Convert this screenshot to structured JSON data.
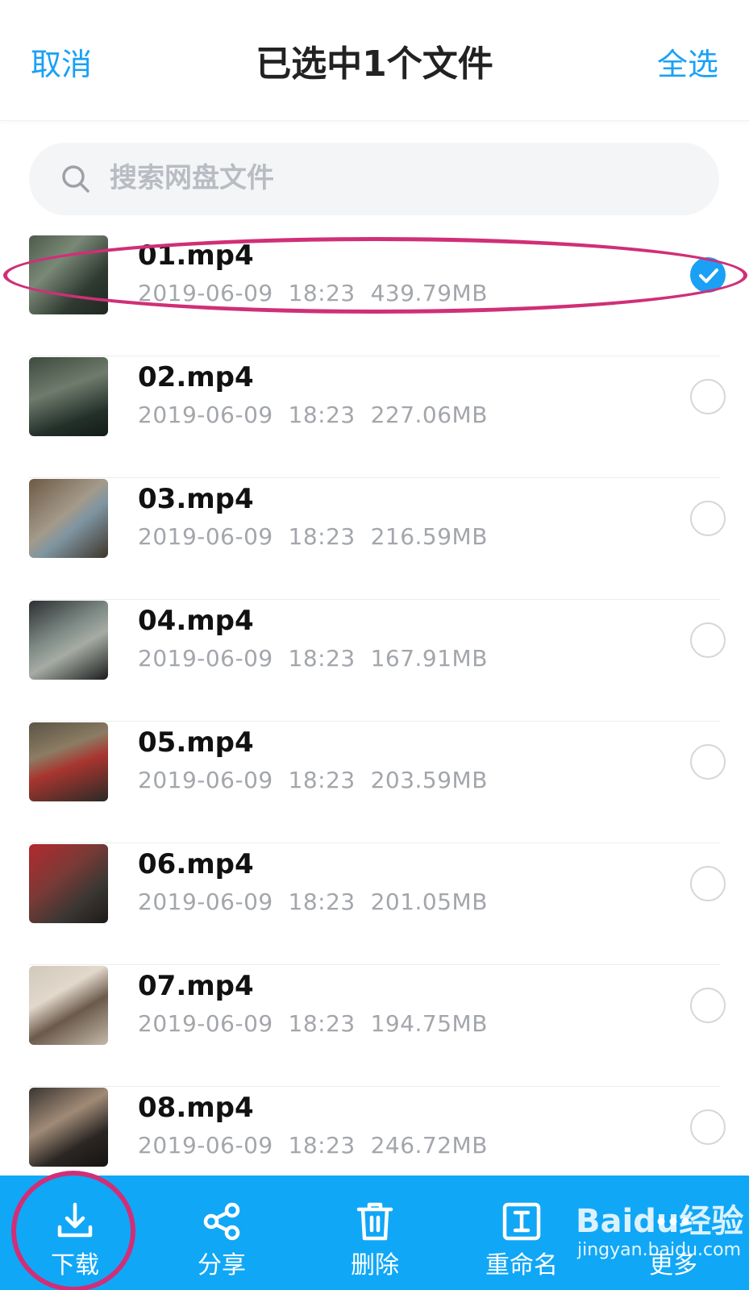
{
  "header": {
    "cancel_label": "取消",
    "title": "已选中1个文件",
    "select_all_label": "全选"
  },
  "search": {
    "placeholder": "搜索网盘文件"
  },
  "files": [
    {
      "name": "01.mp4",
      "date": "2019-06-09",
      "time": "18:23",
      "size": "439.79MB",
      "selected": true
    },
    {
      "name": "02.mp4",
      "date": "2019-06-09",
      "time": "18:23",
      "size": "227.06MB",
      "selected": false
    },
    {
      "name": "03.mp4",
      "date": "2019-06-09",
      "time": "18:23",
      "size": "216.59MB",
      "selected": false
    },
    {
      "name": "04.mp4",
      "date": "2019-06-09",
      "time": "18:23",
      "size": "167.91MB",
      "selected": false
    },
    {
      "name": "05.mp4",
      "date": "2019-06-09",
      "time": "18:23",
      "size": "203.59MB",
      "selected": false
    },
    {
      "name": "06.mp4",
      "date": "2019-06-09",
      "time": "18:23",
      "size": "201.05MB",
      "selected": false
    },
    {
      "name": "07.mp4",
      "date": "2019-06-09",
      "time": "18:23",
      "size": "194.75MB",
      "selected": false
    },
    {
      "name": "08.mp4",
      "date": "2019-06-09",
      "time": "18:23",
      "size": "246.72MB",
      "selected": false
    }
  ],
  "toolbar": {
    "items": [
      {
        "label": "下载",
        "icon": "download-icon"
      },
      {
        "label": "分享",
        "icon": "share-icon"
      },
      {
        "label": "删除",
        "icon": "trash-icon"
      },
      {
        "label": "重命名",
        "icon": "rename-icon"
      },
      {
        "label": "更多",
        "icon": "more-icon"
      }
    ]
  },
  "watermark": {
    "logo": "Baidu经验",
    "url": "jingyan.baidu.com"
  },
  "colors": {
    "accent": "#1aa1f5",
    "toolbar_bg": "#10a7f6",
    "annotation": "#d02f77",
    "meta_text": "#a3a6ab"
  }
}
